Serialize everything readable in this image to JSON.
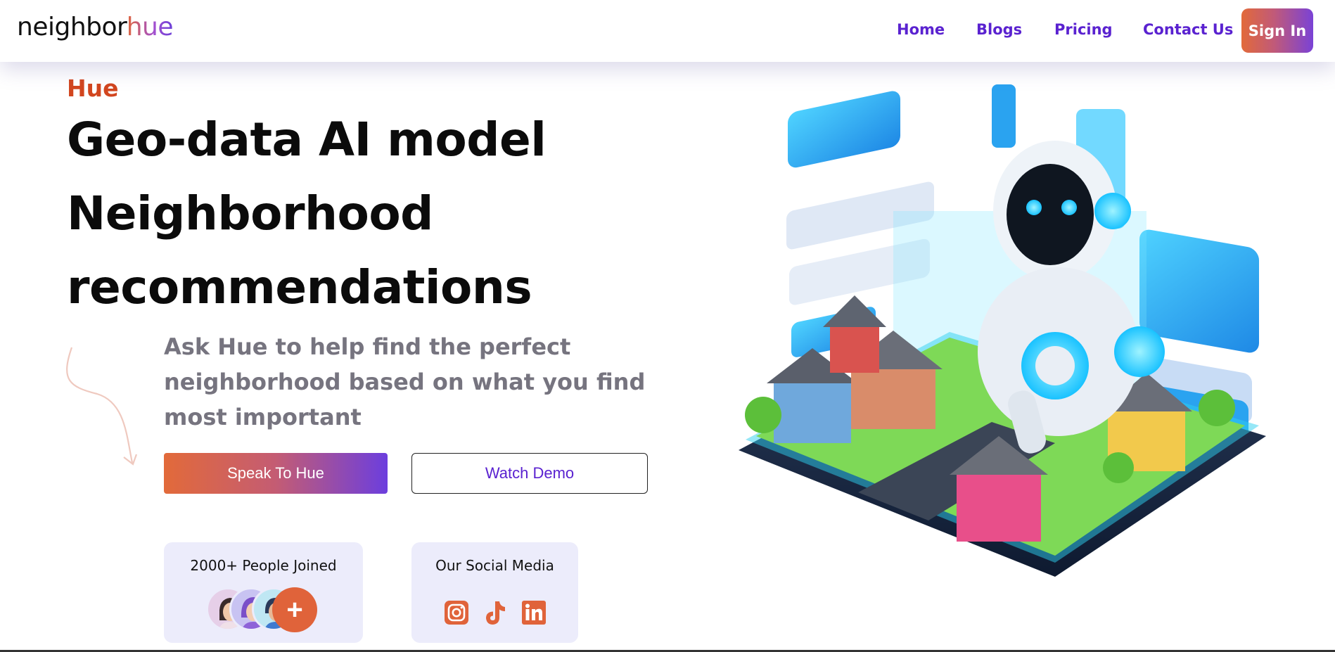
{
  "header": {
    "logo_part1": "neighbor",
    "logo_part2": "hue",
    "nav": [
      "Home",
      "Blogs",
      "Pricing",
      "Contact Us"
    ],
    "signin_label": "Sign In"
  },
  "hero": {
    "eyebrow": "Hue",
    "headline_lines": [
      "Geo-data AI model",
      "Neighborhood",
      "recommendations"
    ],
    "subtext": "Ask Hue to help find the perfect neighborhood based on what you find most important",
    "primary_button": "Speak To Hue",
    "secondary_button": "Watch Demo"
  },
  "cards": {
    "joined_title": "2000+ People Joined",
    "joined_plus": "+",
    "social_title": "Our Social Media",
    "social_icons": [
      "instagram-icon",
      "tiktok-icon",
      "linkedin-icon"
    ]
  },
  "colors": {
    "accent_orange": "#e0633a",
    "accent_purple": "#6a3fd8",
    "nav_purple": "#5a22d0",
    "card_bg": "#ececfb"
  }
}
